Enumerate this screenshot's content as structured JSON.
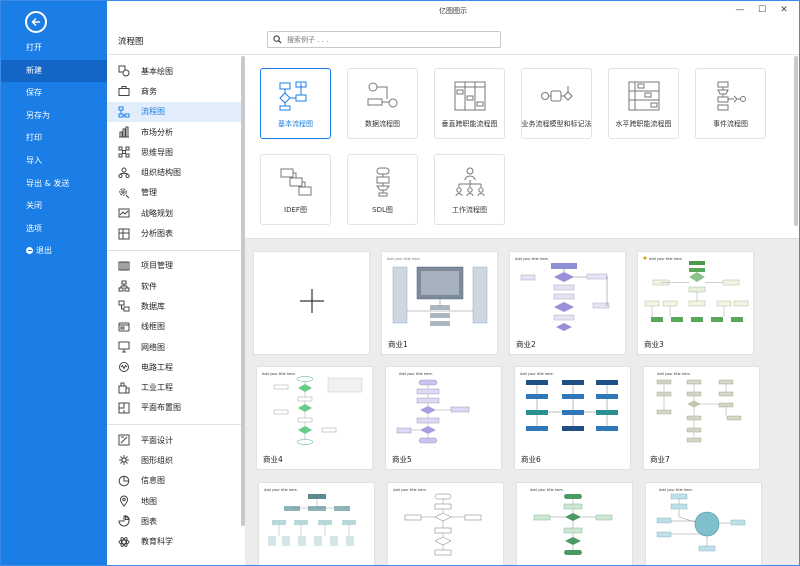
{
  "window": {
    "title": "亿图图示",
    "minimize": "—",
    "maximize": "☐",
    "close": "✕"
  },
  "nav": {
    "back_icon": "arrow-left-circle-icon",
    "items": [
      {
        "label": "打开"
      },
      {
        "label": "新建",
        "active": true
      },
      {
        "label": "保存"
      },
      {
        "label": "另存为"
      },
      {
        "label": "打印"
      },
      {
        "label": "导入"
      },
      {
        "label": "导出 & 发送"
      },
      {
        "label": "关闭"
      },
      {
        "label": "选项"
      },
      {
        "label": "退出"
      }
    ]
  },
  "header": {
    "section_title": "流程图",
    "search_placeholder": "搜索例子 . . ."
  },
  "categories": {
    "group1": [
      {
        "label": "基本绘图",
        "icon": "shapes-icon"
      },
      {
        "label": "商务",
        "icon": "briefcase-icon"
      },
      {
        "label": "流程图",
        "icon": "flowchart-icon",
        "active": true
      },
      {
        "label": "市场分析",
        "icon": "bar-chart-icon"
      },
      {
        "label": "思维导图",
        "icon": "mindmap-icon"
      },
      {
        "label": "组织结构图",
        "icon": "org-chart-icon"
      },
      {
        "label": "管理",
        "icon": "gear-user-icon"
      },
      {
        "label": "战略规划",
        "icon": "strategy-icon"
      },
      {
        "label": "分析图表",
        "icon": "analysis-chart-icon"
      }
    ],
    "group2": [
      {
        "label": "项目管理",
        "icon": "gantt-icon"
      },
      {
        "label": "软件",
        "icon": "software-icon"
      },
      {
        "label": "数据库",
        "icon": "database-icon"
      },
      {
        "label": "线框图",
        "icon": "wireframe-icon"
      },
      {
        "label": "网络图",
        "icon": "network-icon"
      },
      {
        "label": "电路工程",
        "icon": "circuit-icon"
      },
      {
        "label": "工业工程",
        "icon": "industrial-icon"
      },
      {
        "label": "平面布置图",
        "icon": "floorplan-icon"
      }
    ],
    "group3": [
      {
        "label": "平面设计",
        "icon": "design-icon"
      },
      {
        "label": "图形组织",
        "icon": "graphic-organizer-icon"
      },
      {
        "label": "信息图",
        "icon": "infographic-icon"
      },
      {
        "label": "地图",
        "icon": "map-pin-icon"
      },
      {
        "label": "图表",
        "icon": "chart-icon"
      },
      {
        "label": "教育科学",
        "icon": "atom-icon"
      }
    ]
  },
  "diagram_types": [
    {
      "label": "基本流程图",
      "active": true
    },
    {
      "label": "数据流程图"
    },
    {
      "label": "垂直跨职能流程图"
    },
    {
      "label": "业务流程模型和标记法"
    },
    {
      "label": "水平跨职能流程图"
    },
    {
      "label": "事件流程图"
    },
    {
      "label": "IDEF图"
    },
    {
      "label": "SDL图"
    },
    {
      "label": "工作流程图"
    }
  ],
  "templates": {
    "blank_icon": "plus-icon",
    "thumb_title": "Add your title here.",
    "items": [
      {
        "label": "商业1"
      },
      {
        "label": "商业2"
      },
      {
        "label": "商业3"
      },
      {
        "label": "商业4"
      },
      {
        "label": "商业5"
      },
      {
        "label": "商业6"
      },
      {
        "label": "商业7"
      },
      {
        "label": ""
      },
      {
        "label": ""
      },
      {
        "label": ""
      },
      {
        "label": ""
      }
    ]
  },
  "colors": {
    "nav_blue": "#1b7de6",
    "nav_active": "#1466c6",
    "accent": "#1b7de6"
  }
}
